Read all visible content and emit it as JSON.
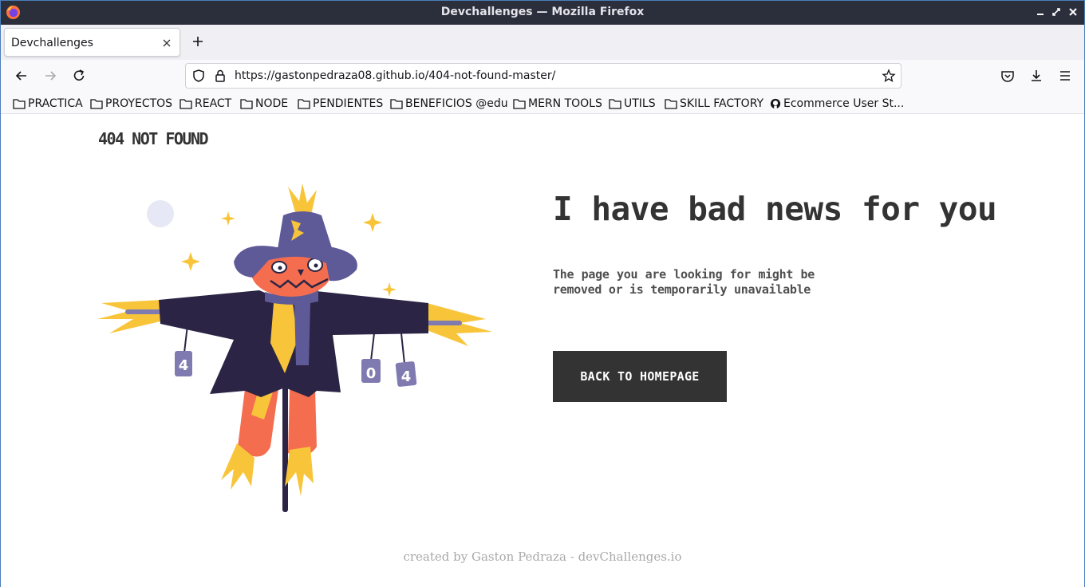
{
  "window": {
    "title": "Devchallenges — Mozilla Firefox"
  },
  "tabs": [
    {
      "label": "Devchallenges"
    }
  ],
  "address_bar": {
    "url": "https://gastonpedraza08.github.io/404-not-found-master/"
  },
  "bookmarks": [
    {
      "label": "PRACTICA",
      "icon": "folder-icon"
    },
    {
      "label": "PROYECTOS",
      "icon": "folder-icon"
    },
    {
      "label": "REACT",
      "icon": "folder-icon"
    },
    {
      "label": "NODE",
      "icon": "folder-icon"
    },
    {
      "label": "PENDIENTES",
      "icon": "folder-icon"
    },
    {
      "label": "BENEFICIOS @edu",
      "icon": "folder-icon"
    },
    {
      "label": "MERN TOOLS",
      "icon": "folder-icon"
    },
    {
      "label": "UTILS",
      "icon": "folder-icon"
    },
    {
      "label": "SKILL FACTORY",
      "icon": "folder-icon"
    },
    {
      "label": "Ecommerce User St...",
      "icon": "github-icon"
    }
  ],
  "page": {
    "logo": "404 NOT FOUND",
    "headline": "I have bad news for you",
    "message": "The page you are looking for might be removed or is temporarily unavailable",
    "button_label": "BACK TO HOMEPAGE",
    "footer": "created by Gaston Pedraza - devChallenges.io",
    "illustration": {
      "can_left": "4",
      "can_middle": "0",
      "can_right": "4"
    }
  },
  "colors": {
    "titlebar": "#2b2e3b",
    "button_bg": "#333333",
    "hat": "#5e5a98",
    "coat": "#2b2445",
    "face": "#f46d4f",
    "straw": "#f8c53a"
  }
}
